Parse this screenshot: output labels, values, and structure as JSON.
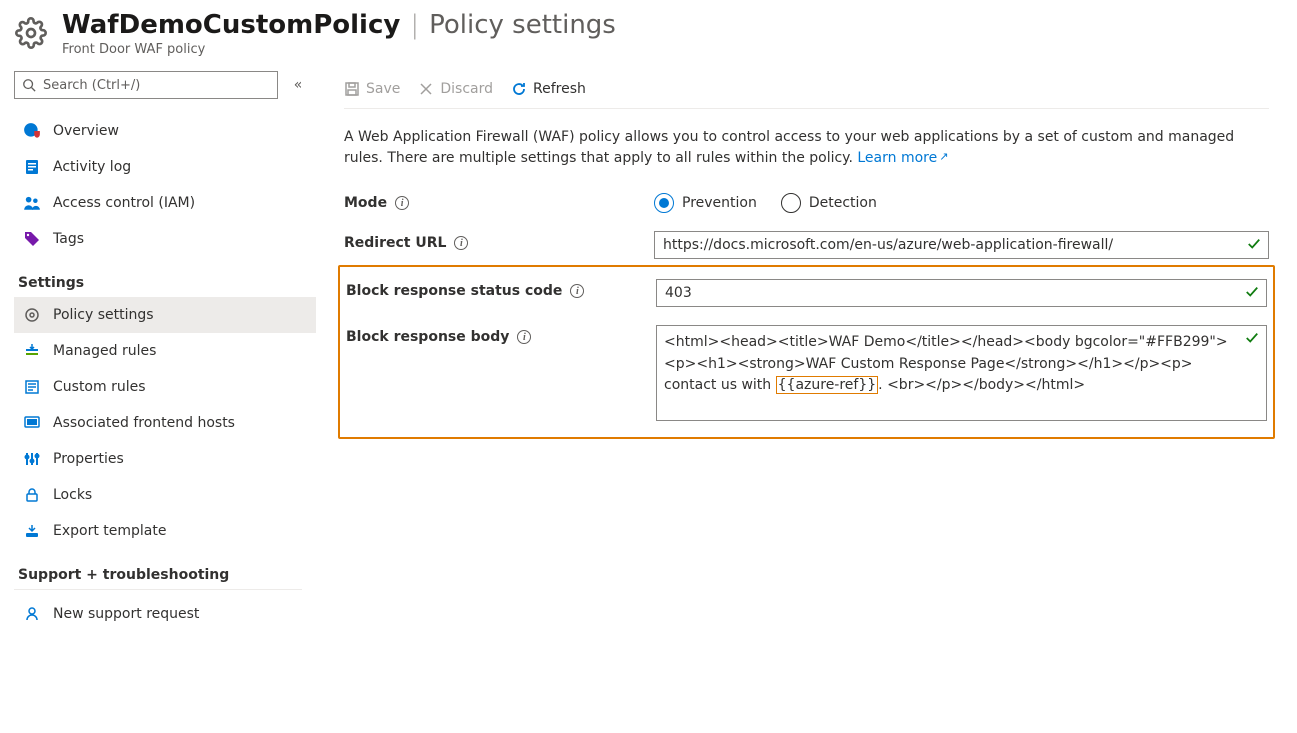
{
  "header": {
    "resource_name": "WafDemoCustomPolicy",
    "page_title": "Policy settings",
    "resource_type": "Front Door WAF policy"
  },
  "sidebar": {
    "search_placeholder": "Search (Ctrl+/)",
    "nav_overview": "Overview",
    "nav_activity_log": "Activity log",
    "nav_access_control": "Access control (IAM)",
    "nav_tags": "Tags",
    "group_settings": "Settings",
    "nav_policy_settings": "Policy settings",
    "nav_managed_rules": "Managed rules",
    "nav_custom_rules": "Custom rules",
    "nav_assoc_hosts": "Associated frontend hosts",
    "nav_properties": "Properties",
    "nav_locks": "Locks",
    "nav_export": "Export template",
    "group_support": "Support + troubleshooting",
    "nav_support_request": "New support request"
  },
  "toolbar": {
    "save": "Save",
    "discard": "Discard",
    "refresh": "Refresh"
  },
  "intro": {
    "text": "A Web Application Firewall (WAF) policy allows you to control access to your web applications by a set of custom and managed rules. There are multiple settings that apply to all rules within the policy.",
    "learn_more": "Learn more"
  },
  "form": {
    "mode_label": "Mode",
    "mode_prevention": "Prevention",
    "mode_detection": "Detection",
    "mode_value": "Prevention",
    "redirect_label": "Redirect URL",
    "redirect_value": "https://docs.microsoft.com/en-us/azure/web-application-firewall/",
    "status_code_label": "Block response status code",
    "status_code_value": "403",
    "body_label": "Block response body",
    "body_value_pre": "<html><head><title>WAF Demo</title></head><body bgcolor=\"#FFB299\"><p><h1><strong>WAF Custom Response Page</strong></h1></p><p> contact us with ",
    "body_value_ref": "{{azure-ref}}",
    "body_value_post": ". <br></p></body></html>"
  }
}
